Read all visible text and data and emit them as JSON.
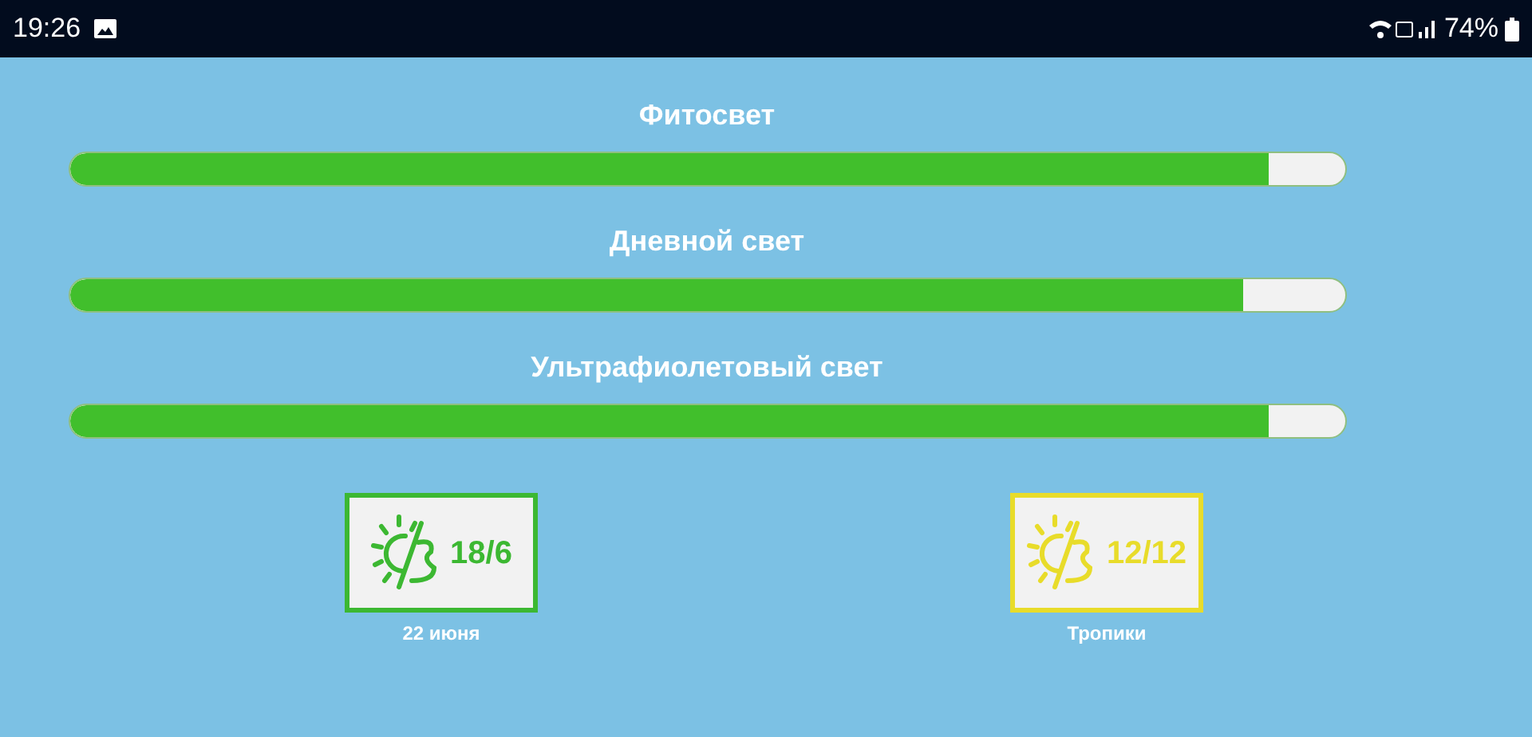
{
  "status_bar": {
    "time": "19:26",
    "battery": "74%"
  },
  "channels": [
    {
      "name": "Фитосвет",
      "level": 0.94
    },
    {
      "name": "Дневной свет",
      "level": 0.92
    },
    {
      "name": "Ультрафиолетовый свет",
      "level": 0.94
    }
  ],
  "modes": [
    {
      "ratio": "18/6",
      "label": "22 июня",
      "color": "#3cb832"
    },
    {
      "ratio": "12/12",
      "label": "Тропики",
      "color": "#e8dc2a"
    }
  ]
}
